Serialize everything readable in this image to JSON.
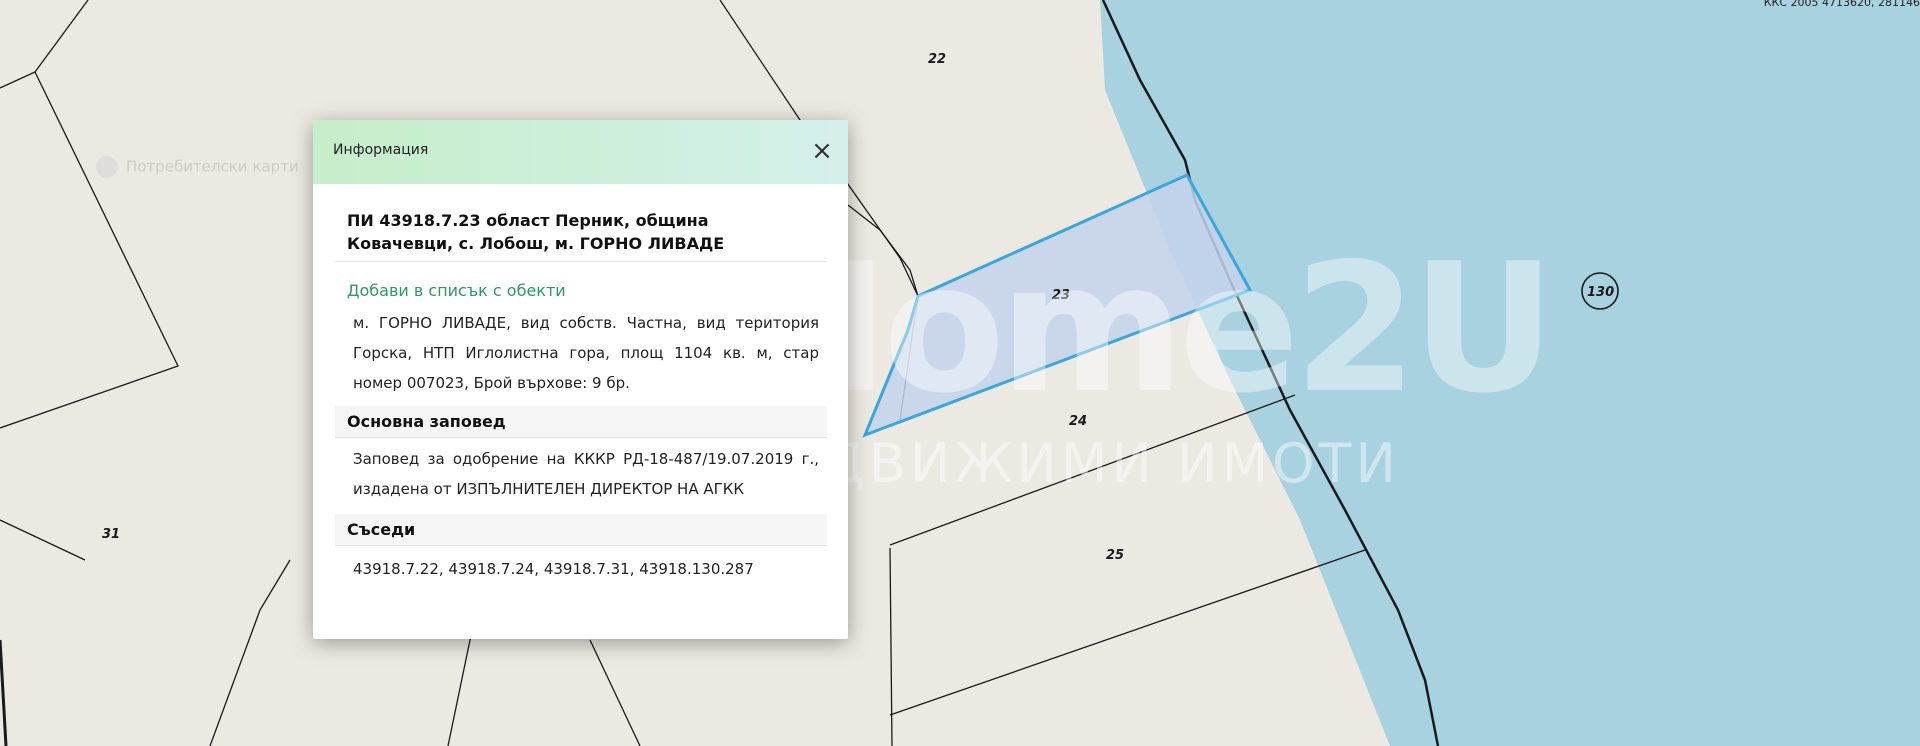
{
  "map": {
    "coordinates_text": "ККС 2005 4713620, 281146",
    "parcel_numbers": [
      "22",
      "23",
      "24",
      "25",
      "31"
    ],
    "circled_number": "130",
    "faded_label": "Потребителски карти",
    "colors": {
      "background": "#ece9e2",
      "water": "#a8d2e0",
      "selected_fill": "#c4d4ec",
      "selected_border": "#3aa6dc",
      "boundary": "#1a1a1a"
    }
  },
  "watermark": {
    "logo": "Home2U",
    "subtitle": "НЕДВИЖИМИ ИМОТИ"
  },
  "popup": {
    "title": "Информация",
    "close_symbol": "×",
    "parcel_title": "ПИ 43918.7.23 област Перник, община Ковачевци, с. Лобош, м. ГОРНО ЛИВАДЕ",
    "add_link": "Добави в списък с обекти",
    "description": "м. ГОРНО ЛИВАДЕ, вид собств. Частна, вид територия Горска, НТП Иглолистна гора, площ 1104 кв. м, стар номер 007023, Брой върхове: 9 бр.",
    "order_heading": "Основна заповед",
    "order_text": "Заповед за одобрение на КККР РД-18-487/19.07.2019 г., издадена от ИЗПЪЛНИТЕЛЕН ДИРЕКТОР НА АГКК",
    "neighbours_heading": "Съседи",
    "neighbours": "43918.7.22, 43918.7.24, 43918.7.31, 43918.130.287"
  }
}
